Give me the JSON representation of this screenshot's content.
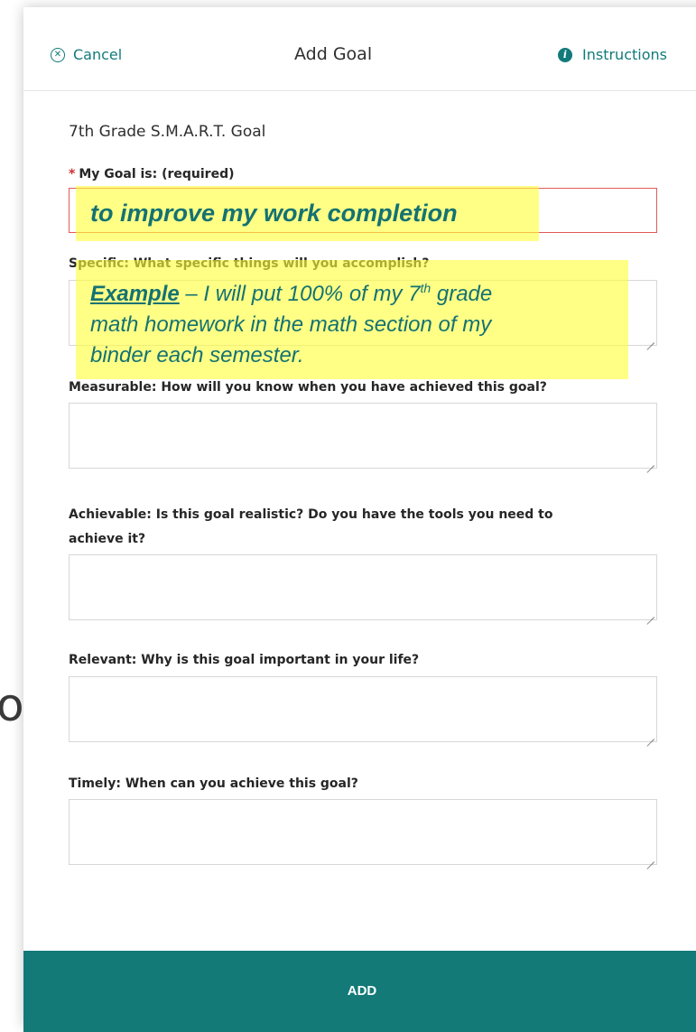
{
  "background": {
    "fragment_text": "on"
  },
  "header": {
    "cancel_label": "Cancel",
    "title": "Add Goal",
    "instructions_label": "Instructions",
    "cancel_icon": "close-circle-icon",
    "instructions_icon": "info-circle-icon"
  },
  "form": {
    "title": "7th Grade S.M.A.R.T. Goal",
    "goal": {
      "required_marker": "*",
      "label": "My Goal is: (required)",
      "value": "to improve my work completion"
    },
    "specific": {
      "label": "Specific: What specific things will you accomplish?",
      "example_word": "Example",
      "example_line1_a": " – I will put 100% of my 7",
      "example_sup": "th",
      "example_line1_b": " grade",
      "example_line2": "math homework in the math section of my",
      "example_line3": "binder each semester."
    },
    "measurable": {
      "label": "Measurable: How will you know when you have achieved this goal?"
    },
    "achievable": {
      "label_line1": "Achievable: Is this goal realistic? Do you have the tools you need to",
      "label_line2": "achieve it?"
    },
    "relevant": {
      "label": "Relevant: Why is this goal important in your life?"
    },
    "timely": {
      "label": "Timely: When can you achieve this goal?"
    }
  },
  "footer": {
    "add_label": "ADD"
  },
  "colors": {
    "accent": "#137a78",
    "highlight": "#ffff3c",
    "required": "#d32f2f"
  }
}
